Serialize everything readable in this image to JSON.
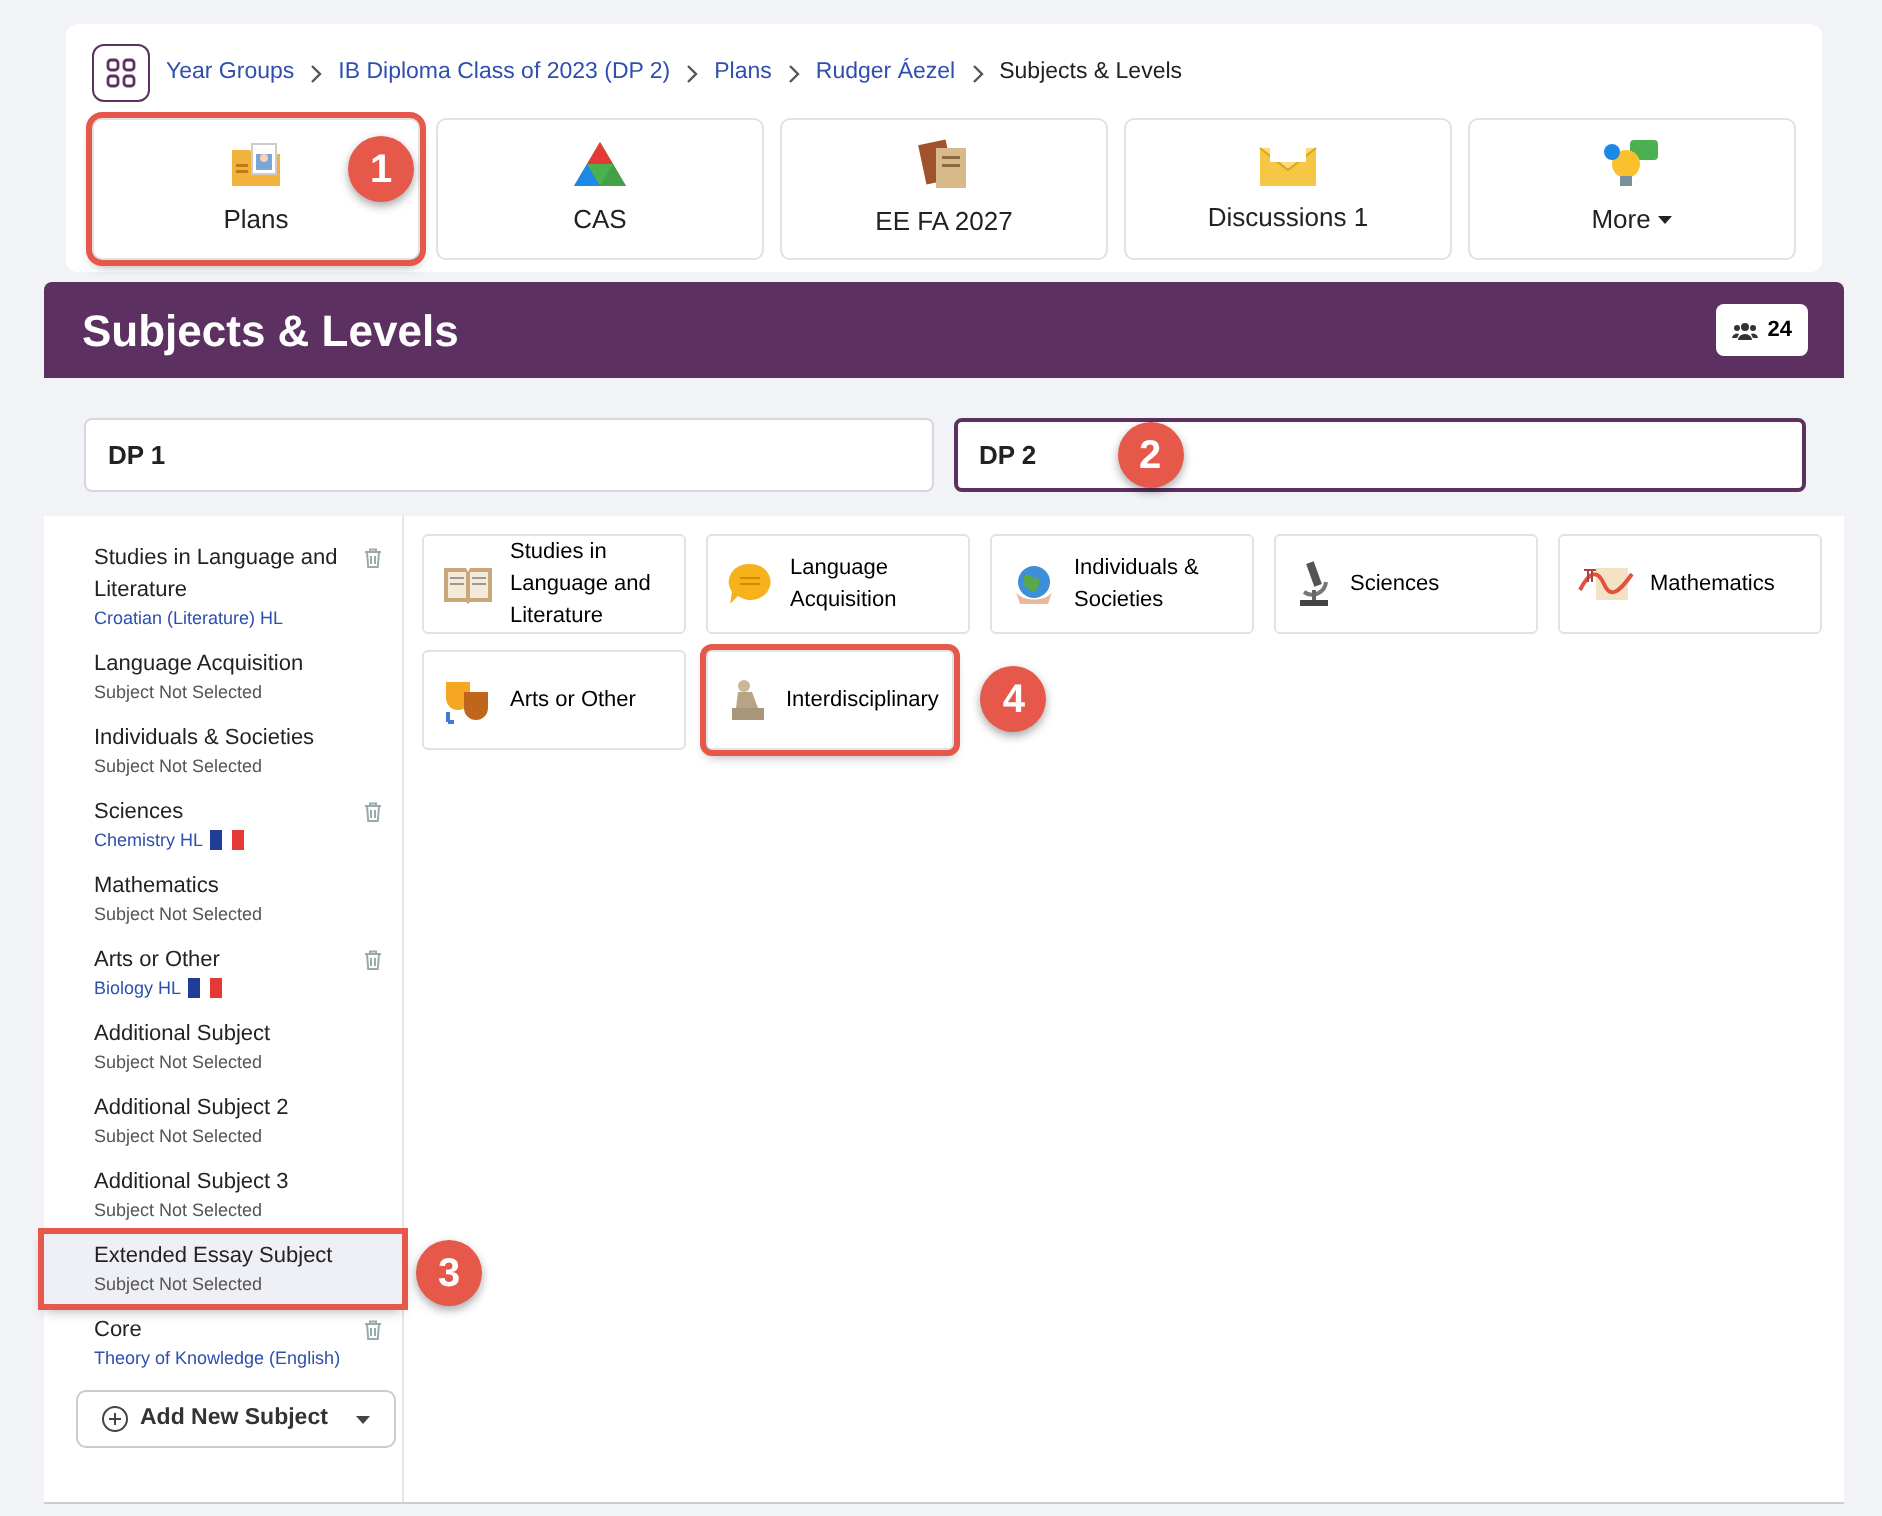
{
  "breadcrumbs": [
    {
      "label": "Year Groups",
      "link": true
    },
    {
      "label": "IB Diploma Class of 2023 (DP 2)",
      "link": true
    },
    {
      "label": "Plans",
      "link": true
    },
    {
      "label": "Rudger Áezel",
      "link": true
    },
    {
      "label": "Subjects & Levels",
      "link": false
    }
  ],
  "app_tabs": [
    {
      "label": "Plans",
      "callout": "1"
    },
    {
      "label": "CAS"
    },
    {
      "label": "EE FA 2027"
    },
    {
      "label": "Discussions 1"
    },
    {
      "label": "More",
      "dropdown": true
    }
  ],
  "header": {
    "title": "Subjects & Levels",
    "count": "24"
  },
  "year_fields": [
    {
      "value": "DP 1",
      "selected": false
    },
    {
      "value": "DP 2",
      "selected": true,
      "callout": "2"
    }
  ],
  "sidebar": {
    "items": [
      {
        "title": "Studies in Language and Literature",
        "subtitle": "Croatian (Literature) HL",
        "assigned": true,
        "deletable": true,
        "flag": false,
        "selected": false
      },
      {
        "title": "Language Acquisition",
        "subtitle": "Subject Not Selected",
        "assigned": false,
        "deletable": false,
        "flag": false,
        "selected": false
      },
      {
        "title": "Individuals & Societies",
        "subtitle": "Subject Not Selected",
        "assigned": false,
        "deletable": false,
        "flag": false,
        "selected": false
      },
      {
        "title": "Sciences",
        "subtitle": "Chemistry HL",
        "assigned": true,
        "deletable": true,
        "flag": true,
        "selected": false
      },
      {
        "title": "Mathematics",
        "subtitle": "Subject Not Selected",
        "assigned": false,
        "deletable": false,
        "flag": false,
        "selected": false
      },
      {
        "title": "Arts or Other",
        "subtitle": "Biology HL",
        "assigned": true,
        "deletable": true,
        "flag": true,
        "selected": false
      },
      {
        "title": "Additional Subject",
        "subtitle": "Subject Not Selected",
        "assigned": false,
        "deletable": false,
        "flag": false,
        "selected": false
      },
      {
        "title": "Additional Subject 2",
        "subtitle": "Subject Not Selected",
        "assigned": false,
        "deletable": false,
        "flag": false,
        "selected": false
      },
      {
        "title": "Additional Subject 3",
        "subtitle": "Subject Not Selected",
        "assigned": false,
        "deletable": false,
        "flag": false,
        "selected": false
      },
      {
        "title": "Extended Essay Subject",
        "subtitle": "Subject Not Selected",
        "assigned": false,
        "deletable": false,
        "flag": false,
        "selected": true,
        "callout": "3"
      },
      {
        "title": "Core",
        "subtitle": "Theory of Knowledge (English)",
        "assigned": true,
        "deletable": true,
        "flag": false,
        "selected": false
      }
    ],
    "add_button": "Add New Subject"
  },
  "subject_groups": [
    {
      "label": "Studies in Language and Literature"
    },
    {
      "label": "Language Acquisition"
    },
    {
      "label": "Individuals & Societies"
    },
    {
      "label": "Sciences"
    },
    {
      "label": "Mathematics"
    },
    {
      "label": "Arts or Other"
    },
    {
      "label": "Interdisciplinary",
      "callout": "4"
    }
  ]
}
